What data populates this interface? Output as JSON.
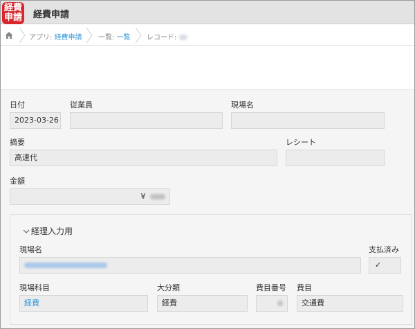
{
  "app": {
    "icon_line1": "経費",
    "icon_line2": "申請",
    "title": "経費申請"
  },
  "breadcrumb": {
    "app_prefix": "アプリ: ",
    "app_name": "経費申請",
    "list_prefix": "一覧: ",
    "list_name": "一覧",
    "record_prefix": "レコード: "
  },
  "fields": {
    "date": {
      "label": "日付",
      "value": "2023-03-26"
    },
    "employee": {
      "label": "従業員",
      "value": ""
    },
    "site_name": {
      "label": "現場名",
      "value": ""
    },
    "summary": {
      "label": "摘要",
      "value": "高速代"
    },
    "receipt": {
      "label": "レシート",
      "value": ""
    },
    "amount": {
      "label": "金額",
      "currency": "¥"
    }
  },
  "group": {
    "title": "経理入力用",
    "site_name": {
      "label": "現場名"
    },
    "paid": {
      "label": "支払済み",
      "value": "✓"
    },
    "site_account": {
      "label": "現場科目",
      "value": "経費"
    },
    "category": {
      "label": "大分類",
      "value": "経費"
    },
    "account_number": {
      "label": "費目番号"
    },
    "account": {
      "label": "費目",
      "value": "交通費"
    }
  },
  "colors": {
    "accent_red": "#d7262c",
    "link_blue": "#3498db",
    "header_bg": "#e3e3e3",
    "field_bg": "#ececec"
  }
}
